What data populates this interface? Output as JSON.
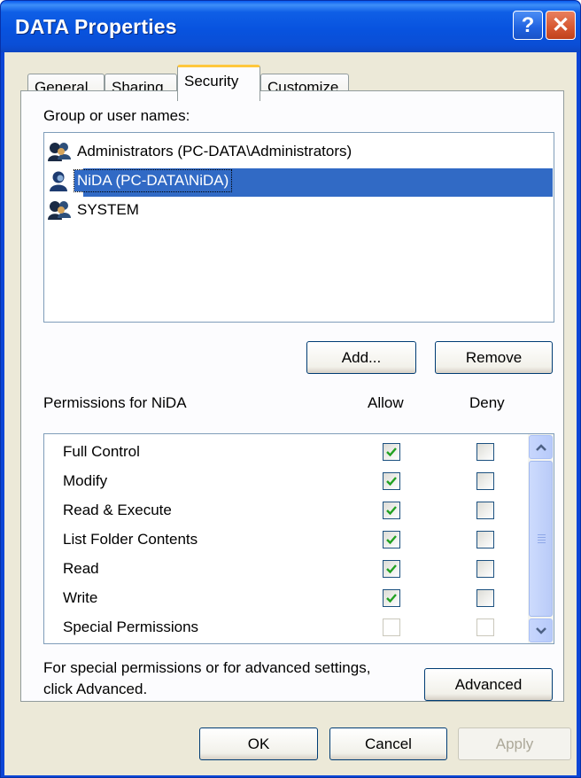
{
  "window": {
    "title": "DATA Properties",
    "help_glyph": "?",
    "close_glyph": "✕"
  },
  "tabs": [
    {
      "label": "General",
      "active": false
    },
    {
      "label": "Sharing",
      "active": false
    },
    {
      "label": "Security",
      "active": true
    },
    {
      "label": "Customize",
      "active": false
    }
  ],
  "users": {
    "label": "Group or user names:",
    "items": [
      {
        "name": "Administrators (PC-DATA\\Administrators)",
        "icon": "group-icon",
        "selected": false
      },
      {
        "name": "NiDA (PC-DATA\\NiDA)",
        "icon": "user-icon",
        "selected": true
      },
      {
        "name": "SYSTEM",
        "icon": "group-icon",
        "selected": false
      }
    ],
    "add_button": "Add...",
    "remove_button": "Remove"
  },
  "permissions": {
    "label": "Permissions for NiDA",
    "allow_header": "Allow",
    "deny_header": "Deny",
    "rows": [
      {
        "name": "Full Control",
        "allow": true,
        "deny": false
      },
      {
        "name": "Modify",
        "allow": true,
        "deny": false
      },
      {
        "name": "Read & Execute",
        "allow": true,
        "deny": false
      },
      {
        "name": "List Folder Contents",
        "allow": true,
        "deny": false
      },
      {
        "name": "Read",
        "allow": true,
        "deny": false
      },
      {
        "name": "Write",
        "allow": true,
        "deny": false
      },
      {
        "name": "Special Permissions",
        "allow": false,
        "deny": false
      }
    ]
  },
  "advanced": {
    "text_line1": "For special permissions or for advanced settings,",
    "text_line2": "click Advanced.",
    "button": "Advanced"
  },
  "footer": {
    "ok": "OK",
    "cancel": "Cancel",
    "apply": "Apply"
  },
  "colors": {
    "accent_blue": "#0c46d6",
    "selection": "#316ac5",
    "check_green": "#21a121",
    "tab_highlight": "#ffc73c"
  }
}
